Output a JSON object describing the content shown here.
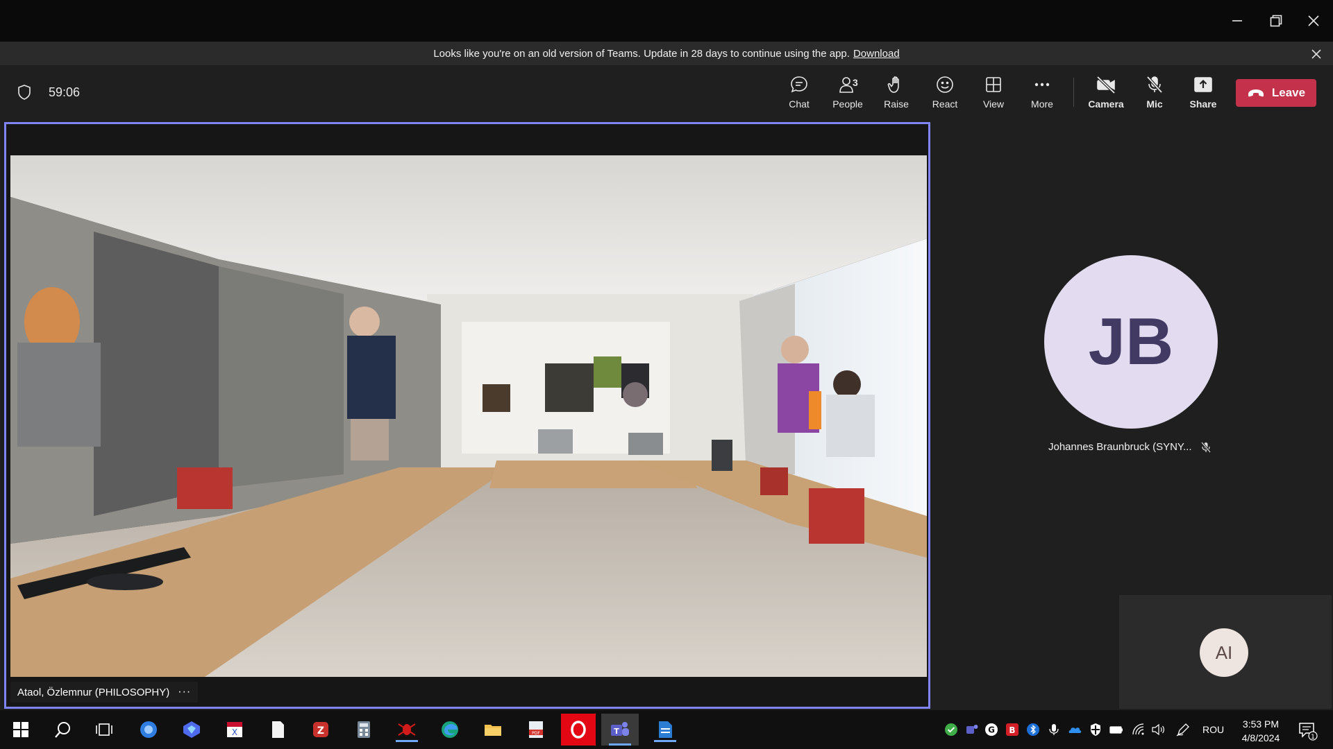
{
  "window": {
    "minimize_label": "minimize",
    "maximize_label": "restore",
    "close_label": "close"
  },
  "banner": {
    "text": "Looks like you're on an old version of Teams. Update in 28 days to continue using the app.",
    "link": "Download"
  },
  "toolbar": {
    "timer": "59:06",
    "chat": "Chat",
    "people": "People",
    "people_count": "3",
    "raise": "Raise",
    "react": "React",
    "view": "View",
    "more": "More",
    "camera": "Camera",
    "mic": "Mic",
    "share": "Share",
    "leave": "Leave"
  },
  "main_video": {
    "participant_name": "Ataol, Özlemnur (PHILOSOPHY)",
    "more": "···"
  },
  "participants": [
    {
      "initials": "JB",
      "name": "Johannes Braunbruck (SYNY...",
      "muted": true
    }
  ],
  "self_view": {
    "initials": "AI"
  },
  "taskbar": {
    "lang": "ROU",
    "time": "3:53 PM",
    "date": "4/8/2024",
    "notification_count": "1"
  },
  "colors": {
    "accent": "#7f85f5",
    "leave": "#c4314b",
    "titlebar": "#0a0a0a",
    "banner": "#2b2b2b",
    "toolbar": "#1f1f1f"
  }
}
